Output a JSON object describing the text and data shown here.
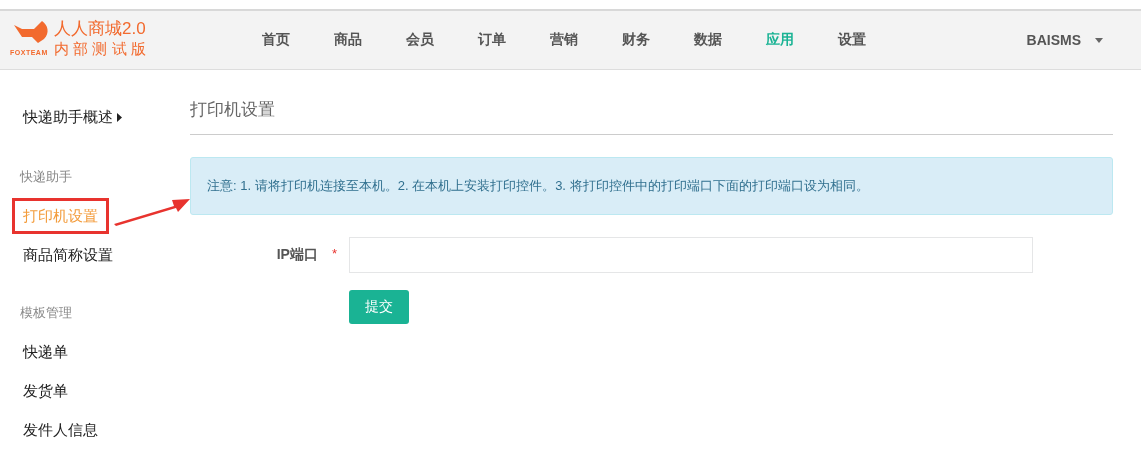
{
  "logo": {
    "brand": "FOXTEAM",
    "title": "人人商城2.0",
    "subtitle": "内 部 测 试 版"
  },
  "nav": [
    {
      "label": "首页",
      "selected": false
    },
    {
      "label": "商品",
      "selected": false
    },
    {
      "label": "会员",
      "selected": false
    },
    {
      "label": "订单",
      "selected": false
    },
    {
      "label": "营销",
      "selected": false
    },
    {
      "label": "财务",
      "selected": false
    },
    {
      "label": "数据",
      "selected": false
    },
    {
      "label": "应用",
      "selected": true
    },
    {
      "label": "设置",
      "selected": false
    }
  ],
  "user": {
    "name": "BAISMS"
  },
  "sidebar": [
    {
      "kind": "link",
      "label": "快递助手概述",
      "selected": false,
      "highlighted": false
    },
    {
      "kind": "header",
      "label": "快递助手"
    },
    {
      "kind": "item",
      "label": "打印机设置",
      "selected": true,
      "highlighted": true
    },
    {
      "kind": "item",
      "label": "商品简称设置",
      "selected": false,
      "highlighted": false
    },
    {
      "kind": "header",
      "label": "模板管理"
    },
    {
      "kind": "item",
      "label": "快递单",
      "selected": false,
      "highlighted": false
    },
    {
      "kind": "item",
      "label": "发货单",
      "selected": false,
      "highlighted": false
    },
    {
      "kind": "item",
      "label": "发件人信息",
      "selected": false,
      "highlighted": false
    }
  ],
  "page_title": "打印机设置",
  "notice": "注意: 1. 请将打印机连接至本机。2. 在本机上安装打印控件。3. 将打印控件中的打印端口下面的打印端口设为相同。",
  "form": {
    "label": "IP端口",
    "required": true,
    "required_mark": "*"
  },
  "submit": "提交"
}
